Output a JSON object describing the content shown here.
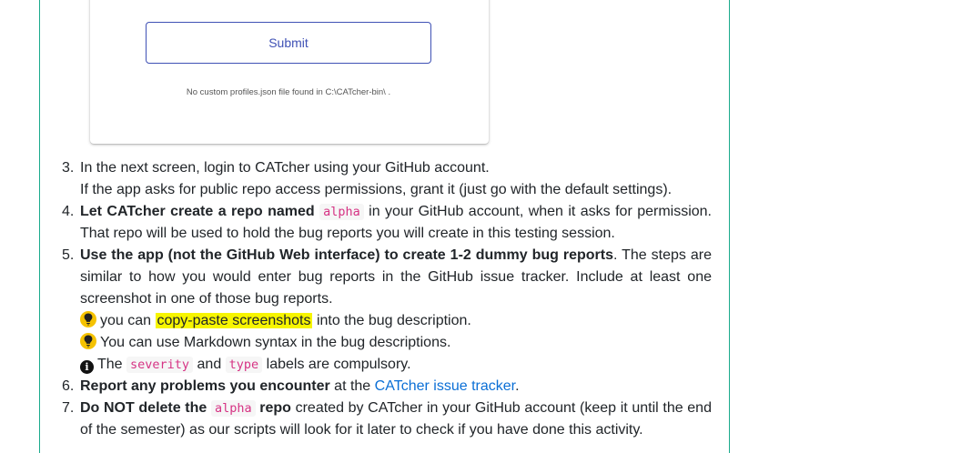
{
  "card": {
    "submit_label": "Submit",
    "profiles_note": "No custom profiles.json file found in C:\\CATcher-bin\\ ."
  },
  "steps": [
    {
      "number": "3.",
      "line1": "In the next screen, login to CATcher using your GitHub account.",
      "line2": "If the app asks for public repo access permissions, grant it (just go with the default settings)."
    },
    {
      "number": "4.",
      "bold": "Let CATcher create a repo named",
      "code": "alpha",
      "rest": "in your GitHub account, when it asks for permission. That repo will be used to hold the bug reports you will create in this testing session."
    },
    {
      "number": "5.",
      "bold": "Use the app (not the GitHub Web interface) to create 1-2 dummy bug reports",
      "rest": ". The steps are similar to how you would enter bug reports in the GitHub issue tracker. Include at least one screenshot in one of those bug reports.",
      "tip1_pre": "you can",
      "tip1_highlight": "copy-paste screenshots",
      "tip1_post": "into the bug description.",
      "tip2": "You can use Markdown syntax in the bug descriptions.",
      "info_pre": "The",
      "info_code1": "severity",
      "info_mid": "and",
      "info_code2": "type",
      "info_post": "labels are compulsory."
    },
    {
      "number": "6.",
      "bold": "Report any problems you encounter",
      "mid": "at the",
      "link": "CATcher issue tracker",
      "end": "."
    },
    {
      "number": "7.",
      "bold_pre": "Do NOT delete the",
      "code": "alpha",
      "bold_post": "repo",
      "rest": "created by CATcher in your GitHub account (keep it until the end of the semester) as our scripts will look for it later to check if you have done this activity."
    }
  ],
  "icons": {
    "tip": "lightbulb-icon",
    "info": "info-circle-icon"
  },
  "colors": {
    "frame_border": "#1aaa8c",
    "button": "#3f51b5",
    "link": "#0b6fd6",
    "highlight": "#f7f500"
  }
}
